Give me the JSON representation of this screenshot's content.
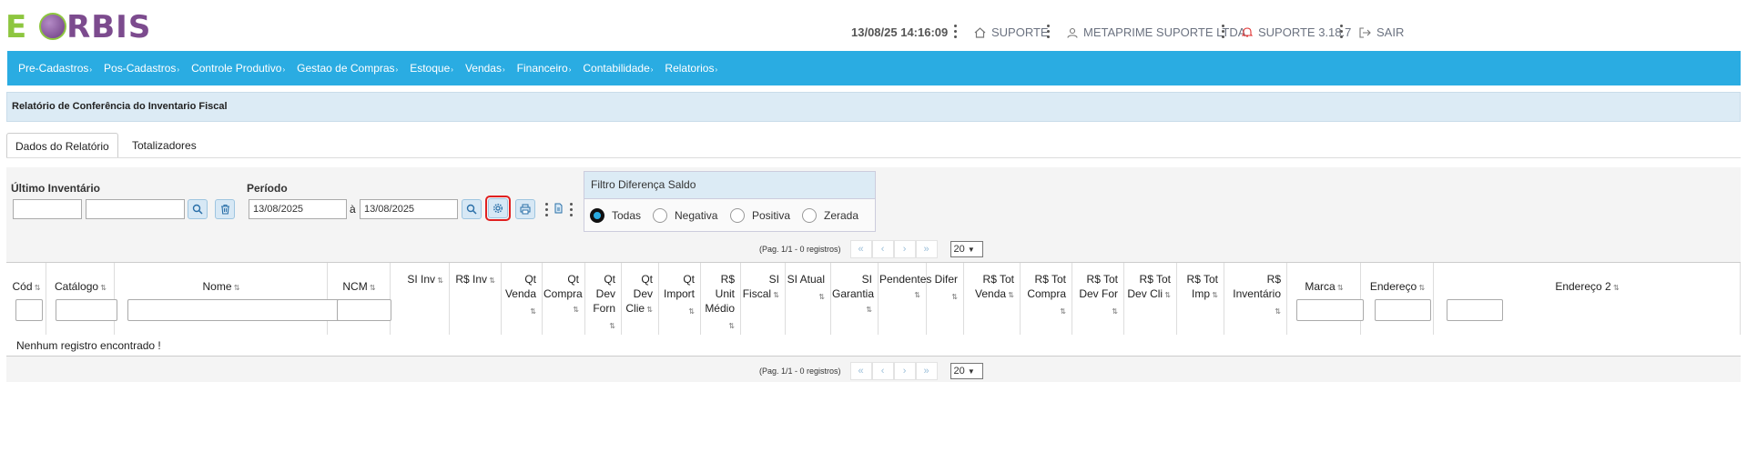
{
  "header": {
    "logo_text": "E ORBIS",
    "datetime": "13/08/25 14:16:09",
    "support": "SUPORTE",
    "company": "METAPRIME SUPORTE LTDA",
    "version": "SUPORTE 3.18.7",
    "logout": "SAIR"
  },
  "menu": [
    "Pre-Cadastros",
    "Pos-Cadastros",
    "Controle Produtivo",
    "Gestao de Compras",
    "Estoque",
    "Vendas",
    "Financeiro",
    "Contabilidade",
    "Relatorios"
  ],
  "page_title": "Relatório de Conferência do Inventario Fiscal",
  "tabs": [
    "Dados do Relatório",
    "Totalizadores"
  ],
  "form": {
    "ultimo_inventario_label": "Último Inventário",
    "periodo_label": "Período",
    "date_from": "13/08/2025",
    "date_sep": "à",
    "date_to": "13/08/2025"
  },
  "filtro": {
    "title": "Filtro Diferença Saldo",
    "options": [
      "Todas",
      "Negativa",
      "Positiva",
      "Zerada"
    ],
    "selected": "Todas"
  },
  "pager": {
    "info": "(Pag. 1/1 - 0 registros)",
    "first": "«",
    "prev": "‹",
    "next": "›",
    "last": "»",
    "page_size": "20"
  },
  "columns": [
    "Cód",
    "Catálogo",
    "Nome",
    "NCM",
    "SI Inv",
    "R$ Inv",
    "Qt Venda",
    "Qt Compra",
    "Qt Dev Forn",
    "Qt Dev Clie",
    "Qt Import",
    "R$ Unit Médio",
    "SI Fiscal",
    "SI Atual",
    "SI Garantia",
    "Pendentes",
    "Difer",
    "R$ Tot Venda",
    "R$ Tot Compra",
    "R$ Tot Dev For",
    "R$ Tot Dev Cli",
    "R$ Tot Imp",
    "R$ Inventário",
    "Marca",
    "Endereço",
    "Endereço 2"
  ],
  "empty_message": "Nenhum registro encontrado !",
  "sort_icon": "⇅",
  "colors": {
    "menubar": "#2aace2",
    "title_bg": "#dcebf5",
    "highlight_border": "#e02020"
  }
}
